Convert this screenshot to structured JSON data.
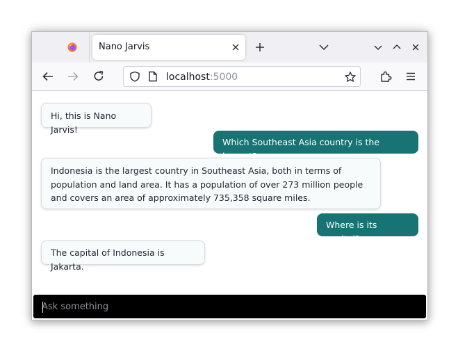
{
  "browser": {
    "tab_title": "Nano Jarvis",
    "url_host": "localhost",
    "url_port": ":5000",
    "icons": [
      "firefox-logo",
      "close-icon",
      "plus-icon",
      "chevron-down-icon",
      "minimize-icon",
      "maximize-icon",
      "window-close-icon",
      "back-icon",
      "forward-icon",
      "reload-icon",
      "shield-icon",
      "page-icon",
      "star-icon",
      "extensions-icon",
      "menu-icon"
    ]
  },
  "chat": {
    "messages": [
      {
        "role": "bot",
        "text": "Hi, this is Nano Jarvis!"
      },
      {
        "role": "user",
        "text": "Which Southeast Asia country is the largest?"
      },
      {
        "role": "bot",
        "text": "Indonesia is the largest country in Southeast Asia, both in terms of population and land area. It has a population of over 273 million people and covers an area of approximately 735,358 square miles."
      },
      {
        "role": "user",
        "text": "Where is its capital?"
      },
      {
        "role": "bot",
        "text": "The capital of Indonesia is Jakarta."
      }
    ],
    "input_placeholder": "Ask something"
  },
  "colors": {
    "user_bubble": "#177374",
    "bot_bubble": "#f8fbfb",
    "input_bar": "#000000",
    "tab_strip": "#f0f0f4"
  }
}
